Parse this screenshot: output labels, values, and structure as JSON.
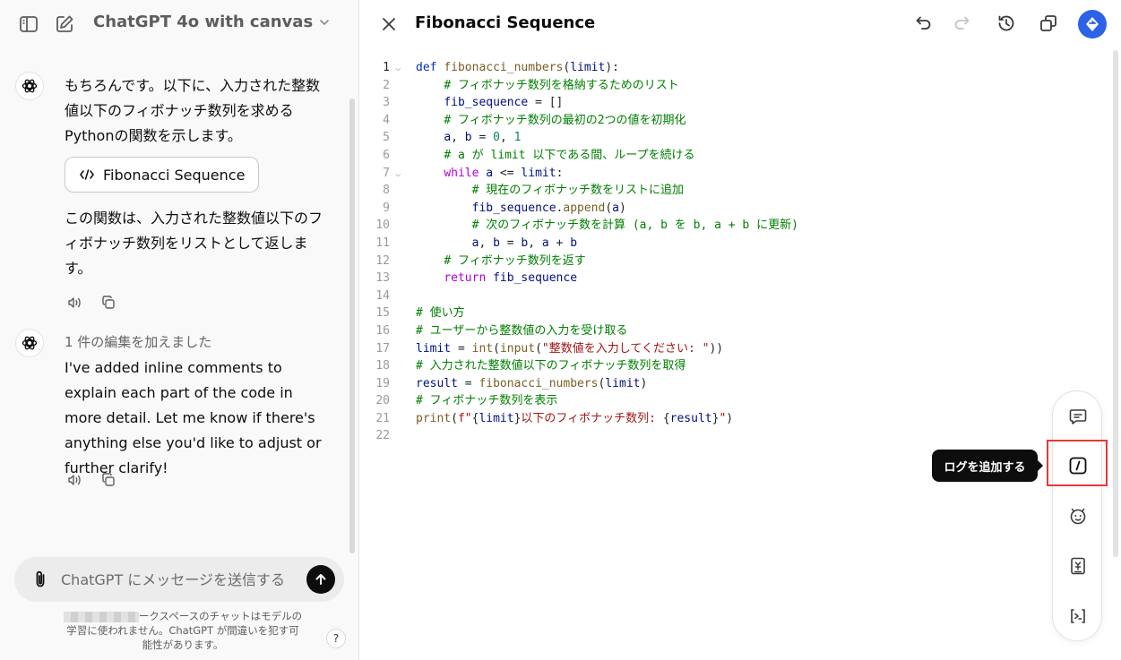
{
  "header": {
    "model_title": "ChatGPT 4o with canvas"
  },
  "messages": [
    {
      "text": "もちろんです。以下に、入力された整数値以下のフィボナッチ数列を求めるPythonの関数を示します。",
      "card_label": "Fibonacci Sequence",
      "text_after": "この関数は、入力された整数値以下のフィボナッチ数列をリストとして返します。"
    },
    {
      "edit_note": "1 件の編集を加えました",
      "text": "I've added inline comments to explain each part of the code in more detail. Let me know if there's anything else you'd like to adjust or further clarify!"
    }
  ],
  "composer": {
    "placeholder": "ChatGPT にメッセージを送信する"
  },
  "disclaimer": {
    "line1": "ークスペースのチャットはモデルの",
    "line2": "学習に使われません。ChatGPT が間違いを犯す可",
    "line3": "能性があります。"
  },
  "help_label": "?",
  "canvas": {
    "title": "Fibonacci Sequence",
    "line_numbers": [
      "1",
      "2",
      "3",
      "4",
      "5",
      "6",
      "7",
      "8",
      "9",
      "10",
      "11",
      "12",
      "13",
      "14",
      "15",
      "16",
      "17",
      "18",
      "19",
      "20",
      "21",
      "22"
    ]
  },
  "tooltip": "ログを追加する",
  "colors": {
    "accent": "#2c63e6",
    "highlight": "#e53935",
    "comment": "#008000"
  }
}
